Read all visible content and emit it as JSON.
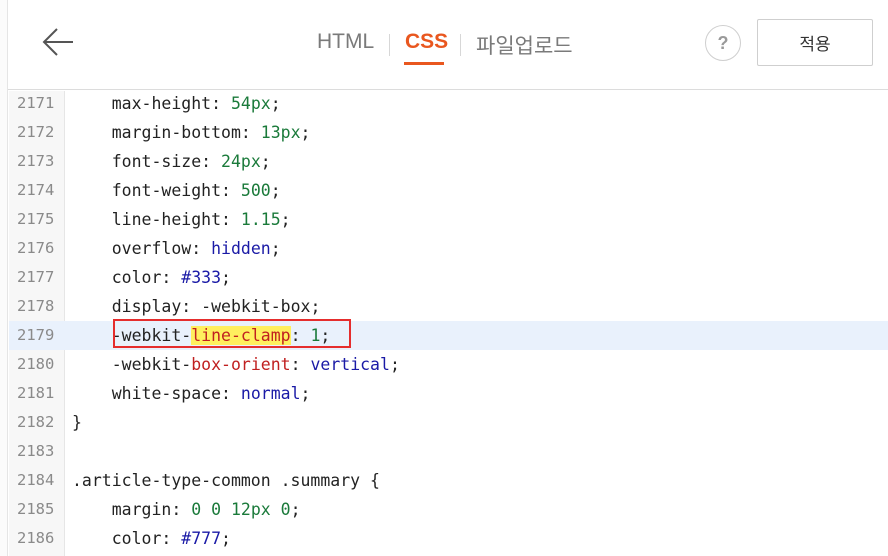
{
  "header": {
    "tabs": [
      "HTML",
      "CSS",
      "파일업로드"
    ],
    "active_tab": "CSS",
    "help_label": "?",
    "apply_label": "적용",
    "accent_color": "#e9571f"
  },
  "icons": {
    "back": "arrow-left-icon",
    "help": "question-icon"
  },
  "editor": {
    "active_line": "2179",
    "lines": [
      {
        "n": "2171",
        "prop": "max-height",
        "val": "54px"
      },
      {
        "n": "2172",
        "prop": "margin-bottom",
        "val": "13px"
      },
      {
        "n": "2173",
        "prop": "font-size",
        "val": "24px"
      },
      {
        "n": "2174",
        "prop": "font-weight",
        "val": "500"
      },
      {
        "n": "2175",
        "prop": "line-height",
        "val": "1.15"
      },
      {
        "n": "2176",
        "prop": "overflow",
        "val": "hidden"
      },
      {
        "n": "2177",
        "prop": "color",
        "val": "#333"
      },
      {
        "n": "2178",
        "prop": "display",
        "val": "-webkit-box"
      },
      {
        "n": "2179",
        "prop_prefix": "-webkit-",
        "prop_hl": "line-clamp",
        "val": "1"
      },
      {
        "n": "2180",
        "prop_prefix": "-webkit-",
        "prop_red": "box-orient",
        "val": "vertical"
      },
      {
        "n": "2181",
        "prop": "white-space",
        "val": "normal"
      },
      {
        "n": "2182",
        "text": "}"
      },
      {
        "n": "2183",
        "text": ""
      },
      {
        "n": "2184",
        "selector": ".article-type-common .summary",
        "brace": "{"
      },
      {
        "n": "2185",
        "prop": "margin",
        "val": "0 0 12px 0"
      },
      {
        "n": "2186",
        "prop": "color",
        "val": "#777"
      }
    ]
  }
}
